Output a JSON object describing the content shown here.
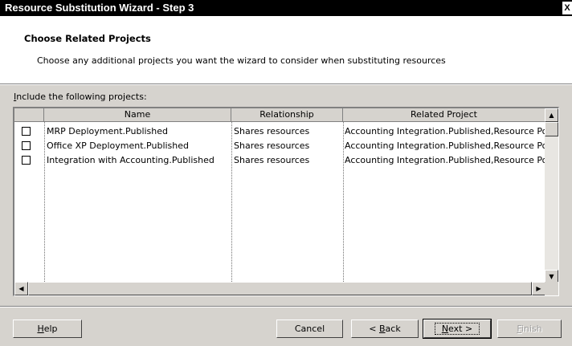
{
  "window": {
    "title": "Resource Substitution Wizard - Step 3",
    "close_glyph": "X"
  },
  "header": {
    "title": "Choose Related Projects",
    "description": "Choose any additional projects you want the wizard to consider when substituting resources"
  },
  "list": {
    "label_prefix": "I",
    "label_rest": "nclude the following projects:",
    "columns": [
      "Name",
      "Relationship",
      "Related Project"
    ],
    "rows": [
      {
        "checked": false,
        "name": "MRP Deployment.Published",
        "relationship": "Shares resources",
        "related": "Accounting Integration.Published,Resource Pool"
      },
      {
        "checked": false,
        "name": "Office XP Deployment.Published",
        "relationship": "Shares resources",
        "related": "Accounting Integration.Published,Resource Pool"
      },
      {
        "checked": false,
        "name": "Integration with Accounting.Published",
        "relationship": "Shares resources",
        "related": "Accounting Integration.Published,Resource Pool"
      }
    ]
  },
  "scroll": {
    "up": "▲",
    "down": "▼",
    "left": "◀",
    "right": "▶"
  },
  "buttons": {
    "help_u": "H",
    "help_rest": "elp",
    "cancel": "Cancel",
    "back_pre": "< ",
    "back_u": "B",
    "back_rest": "ack",
    "next_u": "N",
    "next_rest": "ext >",
    "finish_u": "F",
    "finish_rest": "inish"
  }
}
